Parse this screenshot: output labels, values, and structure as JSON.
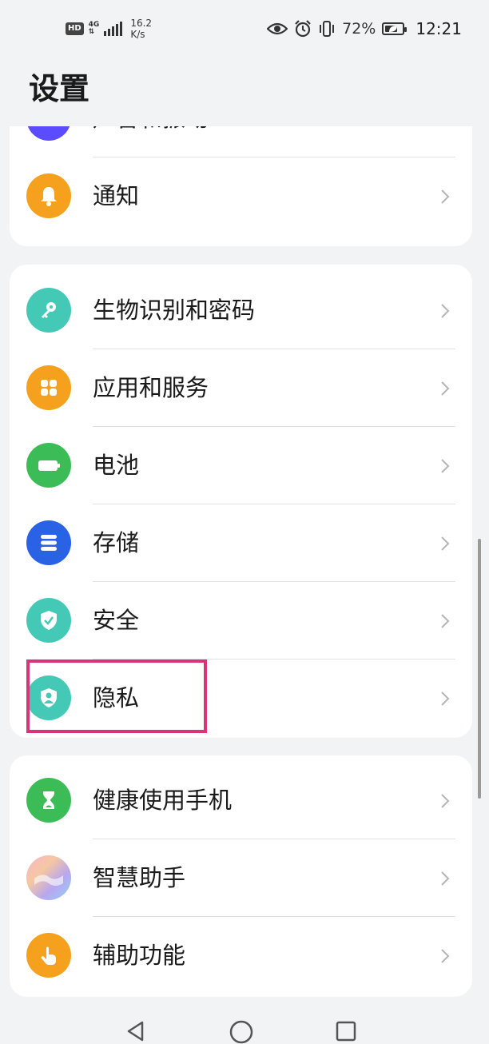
{
  "status_bar": {
    "hd_badge": "HD",
    "network_type": "4G",
    "network_speed_value": "16.2",
    "network_speed_unit": "K/s",
    "battery_percent": "72%",
    "battery_level": 0.72,
    "time": "12:21",
    "icons": [
      "eye-icon",
      "alarm-icon",
      "vibrate-icon",
      "battery-saver-icon"
    ]
  },
  "page": {
    "title": "设置"
  },
  "groups": [
    {
      "items": [
        {
          "label": "声音和振动",
          "icon": "sound-icon",
          "color": "#5b4cff"
        },
        {
          "label": "通知",
          "icon": "bell-icon",
          "color": "#f5a11d"
        }
      ]
    },
    {
      "items": [
        {
          "label": "生物识别和密码",
          "icon": "key-icon",
          "color": "#43c9b6"
        },
        {
          "label": "应用和服务",
          "icon": "apps-grid-icon",
          "color": "#f5a11d"
        },
        {
          "label": "电池",
          "icon": "battery-icon",
          "color": "#3cbc56"
        },
        {
          "label": "存储",
          "icon": "storage-icon",
          "color": "#2a62e6"
        },
        {
          "label": "安全",
          "icon": "shield-check-icon",
          "color": "#43c9b6"
        },
        {
          "label": "隐私",
          "icon": "privacy-shield-icon",
          "color": "#43c9b6"
        }
      ]
    },
    {
      "items": [
        {
          "label": "健康使用手机",
          "icon": "hourglass-icon",
          "color": "#3cbc56"
        },
        {
          "label": "智慧助手",
          "icon": "assistant-icon",
          "color": "#f0a2c4"
        },
        {
          "label": "辅助功能",
          "icon": "accessibility-hand-icon",
          "color": "#f5a11d"
        }
      ]
    }
  ],
  "highlight_color": "#d8347a",
  "nav_bar": {
    "buttons": [
      "back-icon",
      "home-icon",
      "recents-icon"
    ]
  }
}
